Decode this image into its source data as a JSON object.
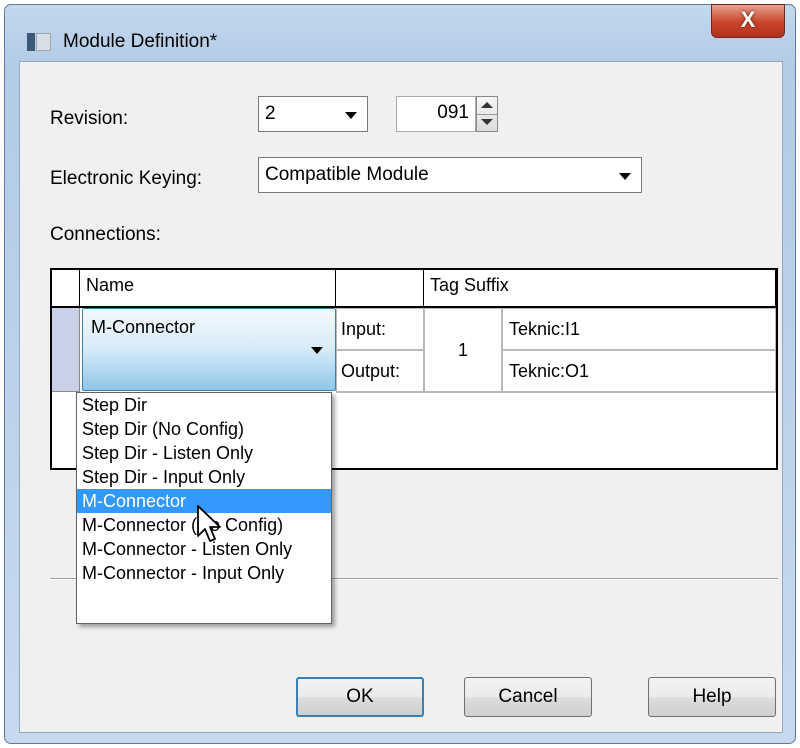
{
  "window": {
    "title": "Module Definition*",
    "close_label": "X"
  },
  "revision": {
    "label": "Revision:",
    "major_value": "2",
    "minor_value": "091"
  },
  "keying": {
    "label": "Electronic Keying:",
    "value": "Compatible Module"
  },
  "connections": {
    "label": "Connections:",
    "headers": {
      "name": "Name",
      "type": "",
      "tag_suffix": "Tag Suffix"
    },
    "row": {
      "name": "M-Connector",
      "input_label": "Input:",
      "output_label": "Output:",
      "rpi": "1",
      "input_tag": "Teknic:I1",
      "output_tag": "Teknic:O1"
    }
  },
  "dropdown": {
    "selected_index": 4,
    "options": [
      "Step Dir",
      "Step Dir (No Config)",
      "Step Dir - Listen Only",
      "Step Dir - Input Only",
      "M-Connector",
      "M-Connector (No Config)",
      "M-Connector - Listen Only",
      "M-Connector - Input Only"
    ]
  },
  "buttons": {
    "ok": "OK",
    "cancel": "Cancel",
    "help": "Help"
  },
  "colors": {
    "selection": "#3399ff",
    "close_button": "#c9442a",
    "row_header": "#c8d1e7"
  }
}
